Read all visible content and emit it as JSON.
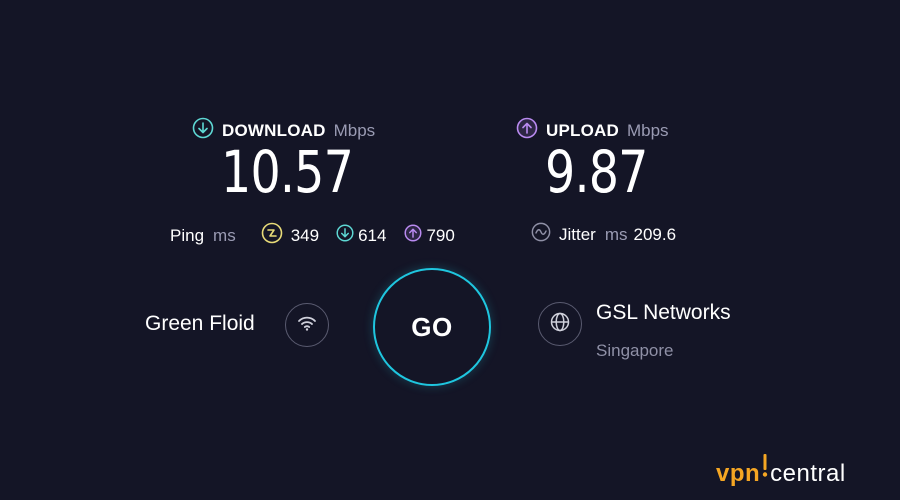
{
  "download": {
    "label": "DOWNLOAD",
    "unit": "Mbps",
    "value": "10.57"
  },
  "upload": {
    "label": "UPLOAD",
    "unit": "Mbps",
    "value": "9.87"
  },
  "ping": {
    "label": "Ping",
    "unit": "ms",
    "idle": "349",
    "download": "614",
    "upload": "790"
  },
  "jitter": {
    "label": "Jitter",
    "unit": "ms",
    "value": "209.6"
  },
  "provider": {
    "name": "Green Floid"
  },
  "go_label": "GO",
  "server": {
    "name": "GSL Networks",
    "location": "Singapore"
  },
  "brand": {
    "part1": "vpn",
    "part2": "central"
  },
  "colors": {
    "background": "#141526",
    "download": "#5ed8d4",
    "upload": "#b98af0",
    "ping_idle": "#e8db78",
    "go_ring": "#1fc6df",
    "brand_orange": "#f5a623"
  },
  "icons": {
    "download": "arrow-down-circle-icon",
    "upload": "arrow-up-circle-icon",
    "ping_idle": "idle-latency-icon",
    "jitter": "wave-icon",
    "provider": "wifi-icon",
    "server": "globe-icon"
  }
}
